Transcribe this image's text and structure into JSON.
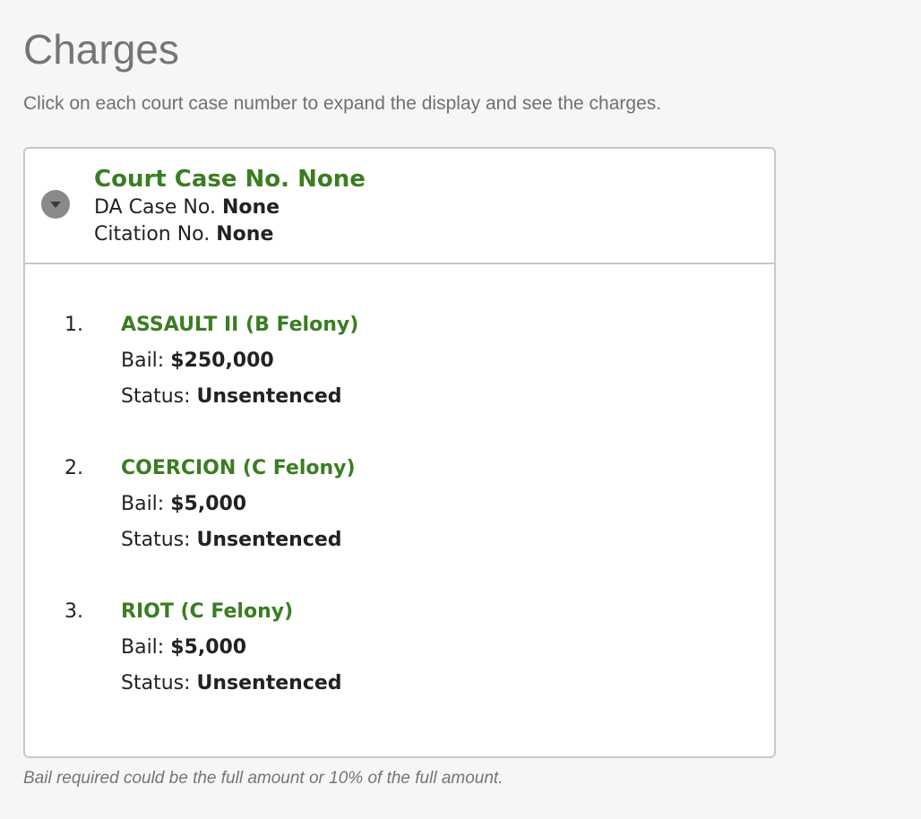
{
  "page": {
    "title": "Charges",
    "instructions": "Click on each court case number to expand the display and see the charges.",
    "footnote": "Bail required could be the full amount or 10% of the full amount."
  },
  "case": {
    "toggle_icon": "chevron-down-icon",
    "title": "Court Case No. None",
    "da_label": "DA Case No.",
    "da_value": "None",
    "citation_label": "Citation No.",
    "citation_value": "None"
  },
  "charges": [
    {
      "number": "1.",
      "name": "ASSAULT II (B Felony)",
      "bail_label": "Bail:",
      "bail": "$250,000",
      "status_label": "Status:",
      "status": "Unsentenced"
    },
    {
      "number": "2.",
      "name": "COERCION (C Felony)",
      "bail_label": "Bail:",
      "bail": "$5,000",
      "status_label": "Status:",
      "status": "Unsentenced"
    },
    {
      "number": "3.",
      "name": "RIOT (C Felony)",
      "bail_label": "Bail:",
      "bail": "$5,000",
      "status_label": "Status:",
      "status": "Unsentenced"
    }
  ],
  "colors": {
    "accent_green": "#3a7d22",
    "heading_gray": "#757575",
    "border_gray": "#c8c8c8"
  }
}
